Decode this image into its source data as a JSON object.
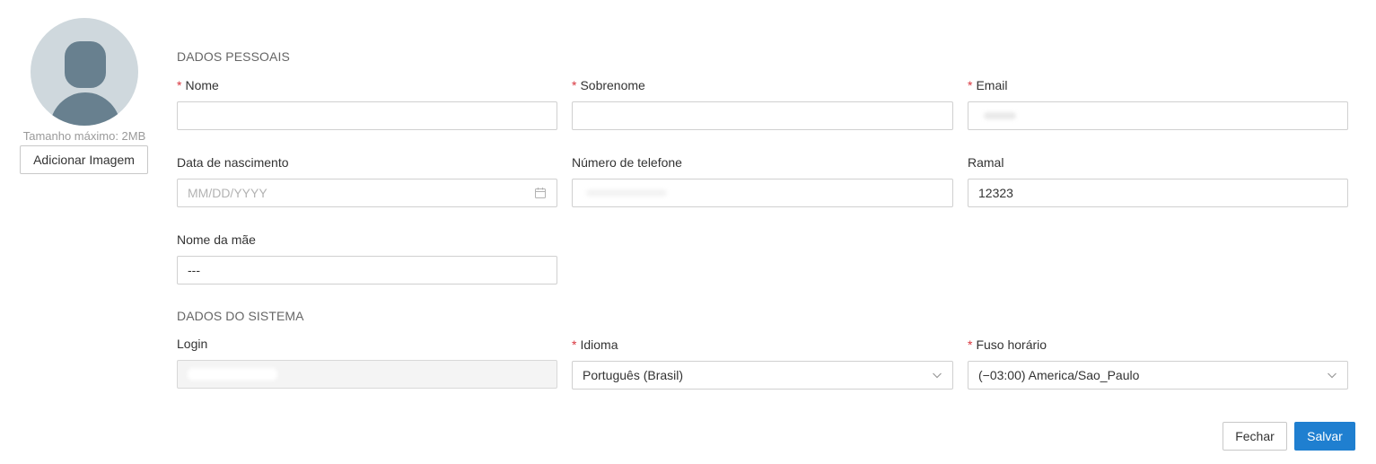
{
  "avatar": {
    "size_hint": "Tamanho máximo: 2MB",
    "add_image_label": "Adicionar Imagem"
  },
  "personal": {
    "section_title": "DADOS PESSOAIS",
    "first_name": {
      "label": "Nome",
      "required": true,
      "value": ""
    },
    "last_name": {
      "label": "Sobrenome",
      "required": true,
      "value": ""
    },
    "email": {
      "label": "Email",
      "required": true,
      "value": ""
    },
    "birth_date": {
      "label": "Data de nascimento",
      "placeholder": "MM/DD/YYYY",
      "value": ""
    },
    "phone": {
      "label": "Número de telefone",
      "value": ""
    },
    "extension": {
      "label": "Ramal",
      "value": "12323"
    },
    "mother_name": {
      "label": "Nome da mãe",
      "value": "---"
    }
  },
  "system": {
    "section_title": "DADOS DO SISTEMA",
    "login": {
      "label": "Login",
      "value": ""
    },
    "language": {
      "label": "Idioma",
      "required": true,
      "value": "Português (Brasil)"
    },
    "timezone": {
      "label": "Fuso horário",
      "required": true,
      "value": "(−03:00) America/Sao_Paulo"
    }
  },
  "footer": {
    "close_label": "Fechar",
    "save_label": "Salvar"
  },
  "icons": {
    "required_marker": "*",
    "calendar": "calendar-icon",
    "dropdown": "chevron-down-icon",
    "avatar": "user-silhouette-icon"
  },
  "colors": {
    "primary": "#1f7fd0",
    "required": "#d9363e",
    "avatar_bg": "#cfd8dd",
    "avatar_fg": "#68808f"
  }
}
